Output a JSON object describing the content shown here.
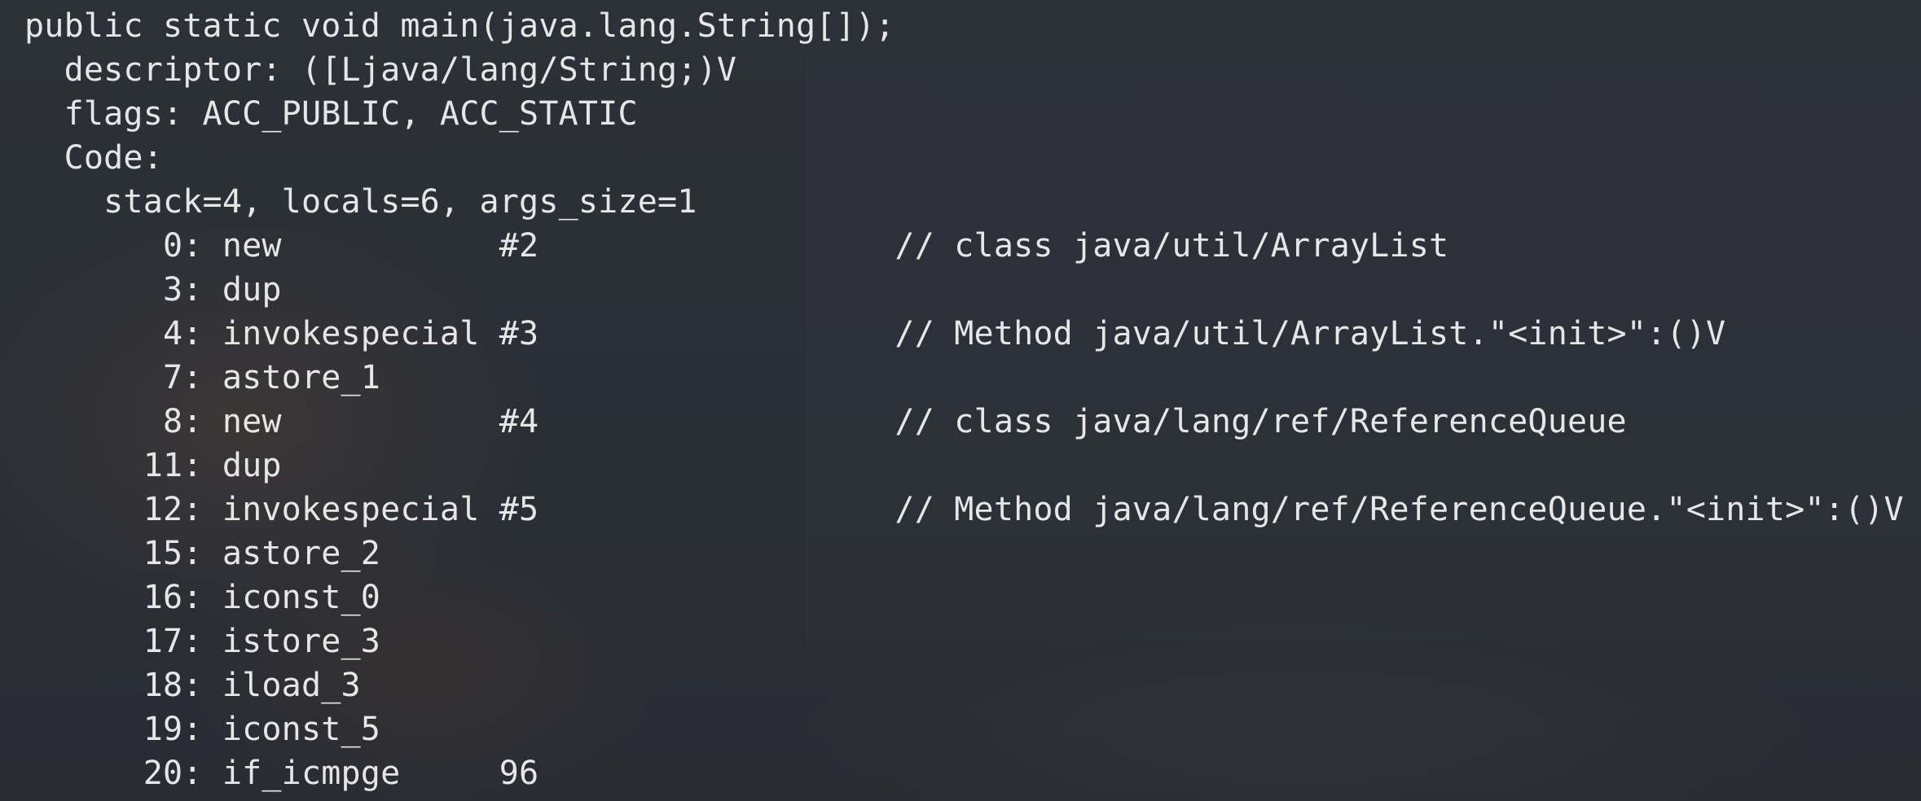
{
  "terminal": {
    "lines": [
      "public static void main(java.lang.String[]);",
      "  descriptor: ([Ljava/lang/String;)V",
      "  flags: ACC_PUBLIC, ACC_STATIC",
      "  Code:",
      "    stack=4, locals=6, args_size=1",
      "       0: new           #2                  // class java/util/ArrayList",
      "       3: dup",
      "       4: invokespecial #3                  // Method java/util/ArrayList.\"<init>\":()V",
      "       7: astore_1",
      "       8: new           #4                  // class java/lang/ref/ReferenceQueue",
      "      11: dup",
      "      12: invokespecial #5                  // Method java/lang/ref/ReferenceQueue.\"<init>\":()V",
      "      15: astore_2",
      "      16: iconst_0",
      "      17: istore_3",
      "      18: iload_3",
      "      19: iconst_5",
      "      20: if_icmpge     96"
    ]
  }
}
